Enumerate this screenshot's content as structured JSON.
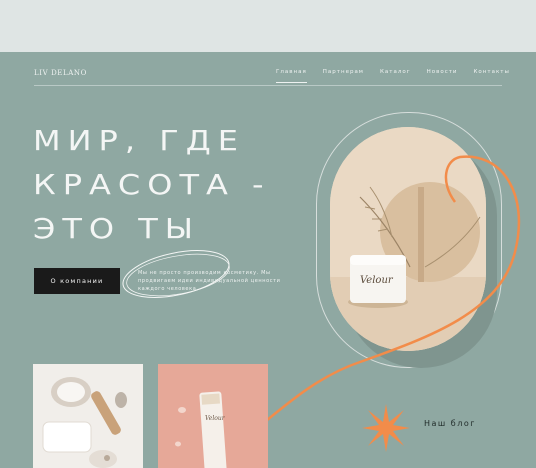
{
  "brand": {
    "logo": "LIV DELANO"
  },
  "nav": {
    "items": [
      "Главная",
      "Партнерам",
      "Каталог",
      "Новости",
      "Контакты"
    ]
  },
  "hero": {
    "line1": "МИР, ГДЕ",
    "line2": "КРАСОТА  -",
    "line3": "ЭТО ТЫ"
  },
  "cta": {
    "label": "О компании"
  },
  "description": "Мы не просто производим косметику. Мы продвигаем идеи индивидуальной ценности каждого человека.",
  "product": {
    "jar_brand": "Velour",
    "tube_brand": "Velour"
  },
  "blog": {
    "label": "Наш блог"
  },
  "colors": {
    "background": "#8fa8a2",
    "accent": "#f28c4a",
    "button": "#1a1a1a"
  }
}
